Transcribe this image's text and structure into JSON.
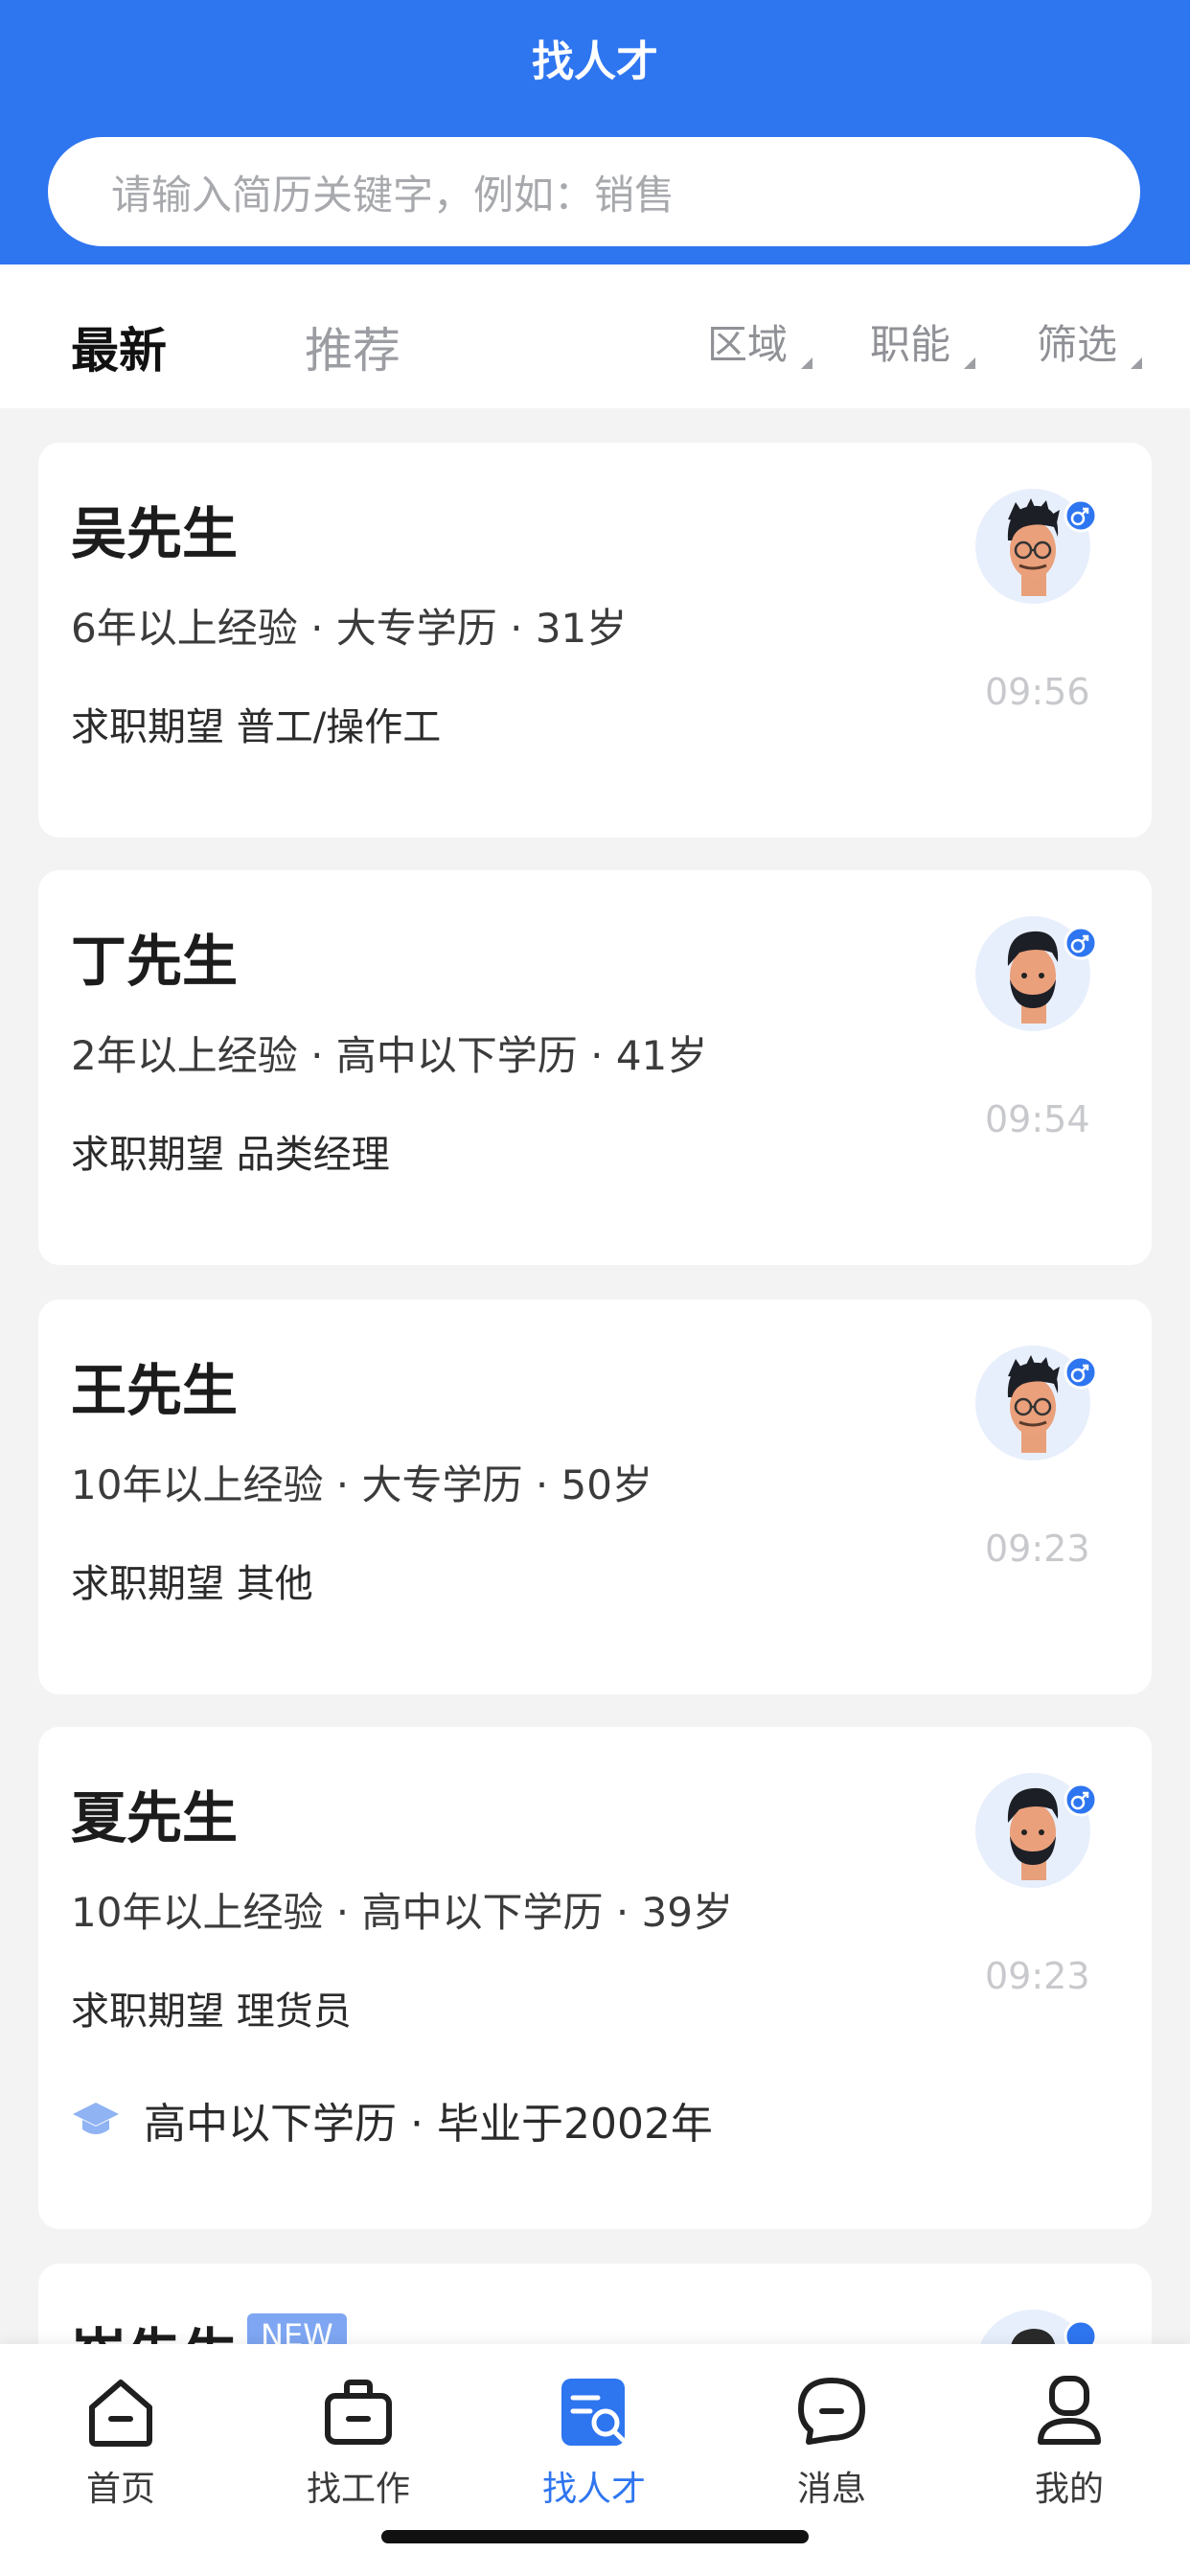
{
  "header": {
    "title": "找人才",
    "search_placeholder": "请输入简历关键字，例如：销售"
  },
  "tabs": {
    "latest": "最新",
    "recommend": "推荐"
  },
  "filters": {
    "area": "区域",
    "function": "职能",
    "filter": "筛选"
  },
  "candidates": [
    {
      "name": "吴先生",
      "meta": "6年以上经验 · 大专学历 · 31岁",
      "want": "求职期望 普工/操作工",
      "time": "09:56",
      "gender_icon": "male-icon"
    },
    {
      "name": "丁先生",
      "meta": "2年以上经验 · 高中以下学历 · 41岁",
      "want": "求职期望 品类经理",
      "time": "09:54",
      "gender_icon": "male-icon"
    },
    {
      "name": "王先生",
      "meta": "10年以上经验 · 大专学历 · 50岁",
      "want": "求职期望 其他",
      "time": "09:23",
      "gender_icon": "male-icon"
    },
    {
      "name": "夏先生",
      "meta": "10年以上经验 · 高中以下学历 · 39岁",
      "want": "求职期望 理货员",
      "time": "09:23",
      "education_line": "高中以下学历 · 毕业于2002年",
      "gender_icon": "male-icon"
    },
    {
      "name": "崔先生",
      "badge": "NEW",
      "gender_icon": "male-icon"
    }
  ],
  "tabbar": {
    "items": [
      {
        "label": "首页",
        "icon": "home-icon"
      },
      {
        "label": "找工作",
        "icon": "briefcase-icon"
      },
      {
        "label": "找人才",
        "icon": "talent-search-icon",
        "active": true
      },
      {
        "label": "消息",
        "icon": "message-icon"
      },
      {
        "label": "我的",
        "icon": "profile-icon"
      }
    ]
  },
  "colors": {
    "brand": "#2e75f0",
    "background": "#f3f3f4",
    "muted": "#c8c9cc"
  }
}
